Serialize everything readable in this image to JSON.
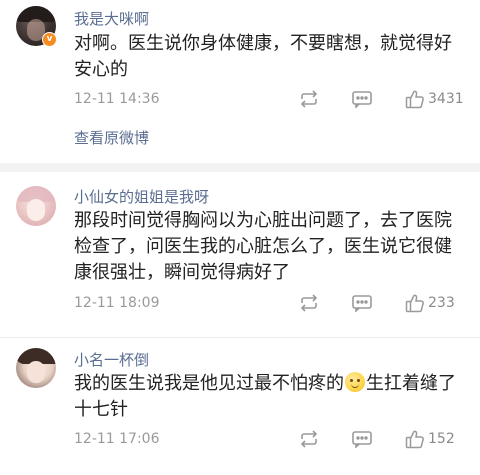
{
  "comments": [
    {
      "username": "我是大咪啊",
      "verified_badge": "v",
      "text": "对啊。医生说你身体健康，不要瞎想，就觉得好安心的",
      "time": "12-11 14:36",
      "likes": "3431",
      "view_original": "查看原微博"
    },
    {
      "username": "小仙女的姐姐是我呀",
      "text": "那段时间觉得胸闷以为心脏出问题了，去了医院检查了，问医生我的心脏怎么了，医生说它很健康很强壮，瞬间觉得病好了",
      "time": "12-11 18:09",
      "likes": "233"
    },
    {
      "username": "小名一杯倒",
      "text_before": "我的医生说我是他见过最不怕疼的",
      "text_after": "生扛着缝了十七针",
      "time": "12-11 17:06",
      "likes": "152"
    }
  ],
  "icons": {
    "repost": "repost-icon",
    "comment": "comment-icon",
    "like": "thumbs-up-icon",
    "emoji": "smile-emoji-icon"
  },
  "colors": {
    "username": "#5a6e91",
    "text": "#222222",
    "meta": "#9a9a9a",
    "badge": "#f78b1f",
    "separator": "#f2f2f2"
  }
}
